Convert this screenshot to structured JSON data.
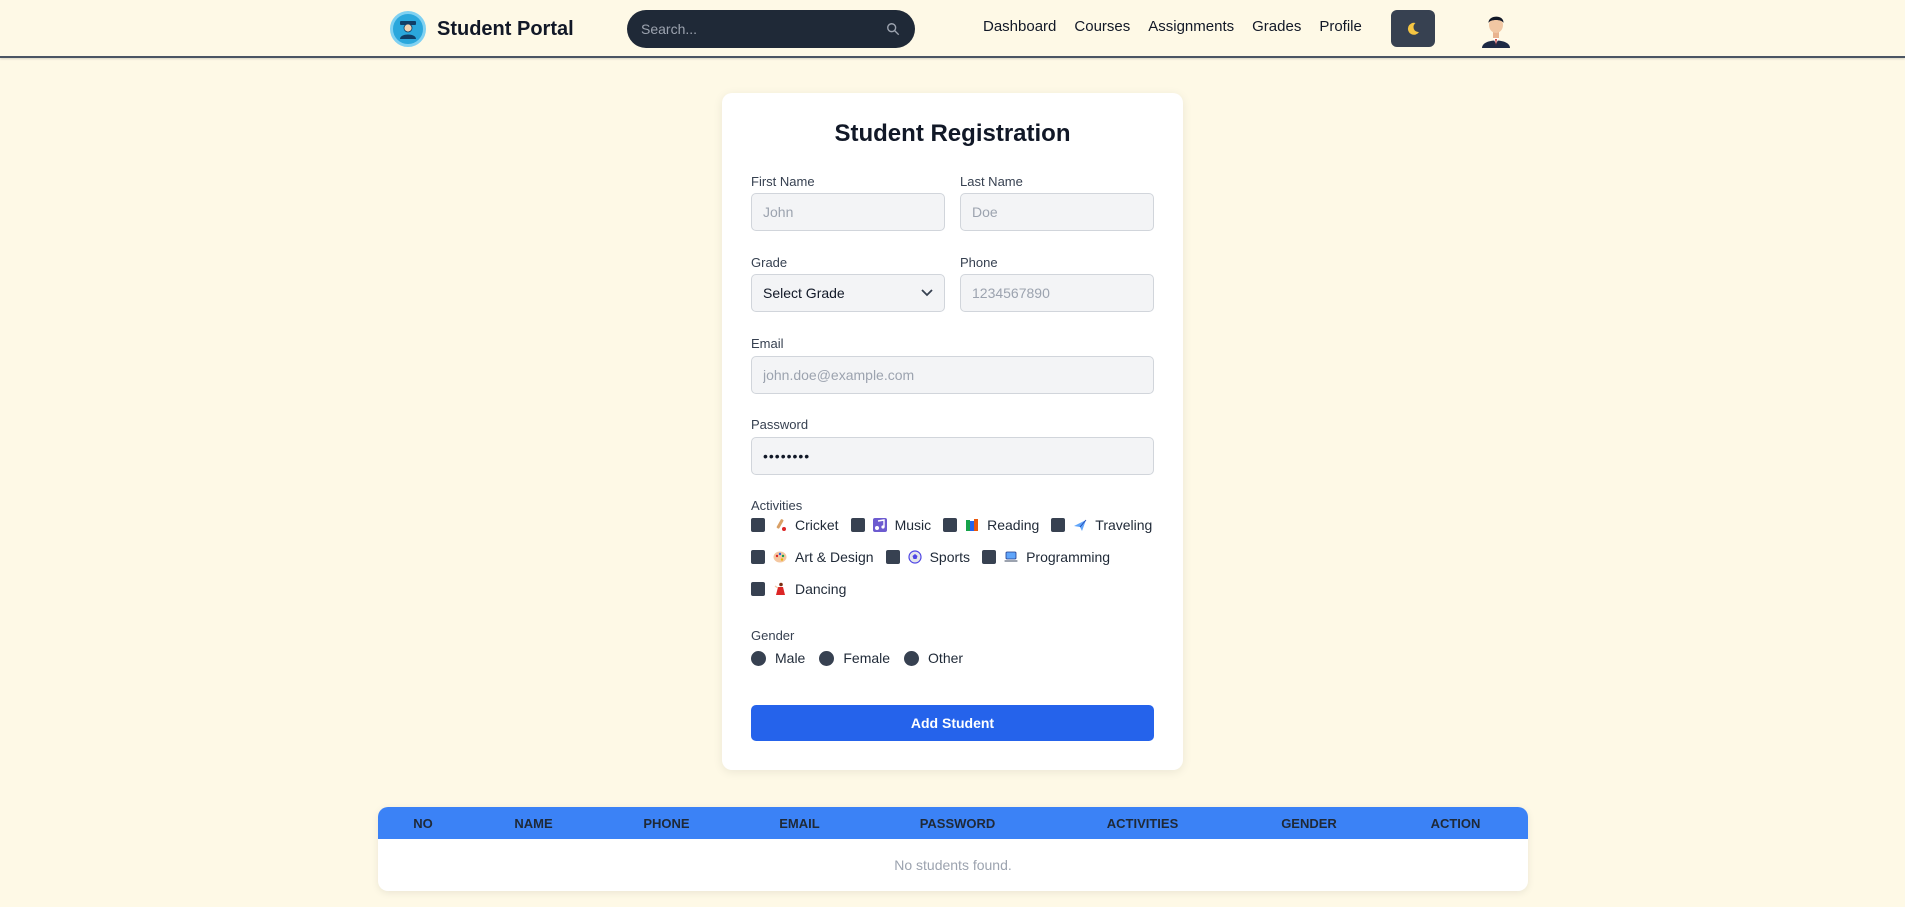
{
  "navbar": {
    "brand": "Student Portal",
    "search_placeholder": "Search...",
    "links": [
      "Dashboard",
      "Courses",
      "Assignments",
      "Grades",
      "Profile"
    ],
    "theme_icon": "moon-icon"
  },
  "form": {
    "title": "Student Registration",
    "first_name": {
      "label": "First Name",
      "placeholder": "John"
    },
    "last_name": {
      "label": "Last Name",
      "placeholder": "Doe"
    },
    "grade": {
      "label": "Grade",
      "selected": "Select Grade"
    },
    "phone": {
      "label": "Phone",
      "placeholder": "1234567890"
    },
    "email": {
      "label": "Email",
      "placeholder": "john.doe@example.com"
    },
    "password": {
      "label": "Password",
      "value": "••••••••"
    },
    "activities_label": "Activities",
    "activities": [
      {
        "label": "Cricket",
        "icon": "cricket-icon"
      },
      {
        "label": "Music",
        "icon": "music-note-icon"
      },
      {
        "label": "Reading",
        "icon": "books-icon"
      },
      {
        "label": "Traveling",
        "icon": "airplane-icon"
      },
      {
        "label": "Art & Design",
        "icon": "palette-icon"
      },
      {
        "label": "Sports",
        "icon": "ball-icon"
      },
      {
        "label": "Programming",
        "icon": "laptop-icon"
      },
      {
        "label": "Dancing",
        "icon": "dancer-icon"
      }
    ],
    "gender_label": "Gender",
    "genders": [
      "Male",
      "Female",
      "Other"
    ],
    "submit_label": "Add Student"
  },
  "table": {
    "columns": [
      "NO",
      "NAME",
      "PHONE",
      "EMAIL",
      "PASSWORD",
      "ACTIVITIES",
      "GENDER",
      "ACTION"
    ],
    "empty_text": "No students found."
  },
  "colors": {
    "background": "#fef9e6",
    "primary": "#2563eb",
    "table_header": "#3b82f6",
    "dark": "#1f2937"
  }
}
